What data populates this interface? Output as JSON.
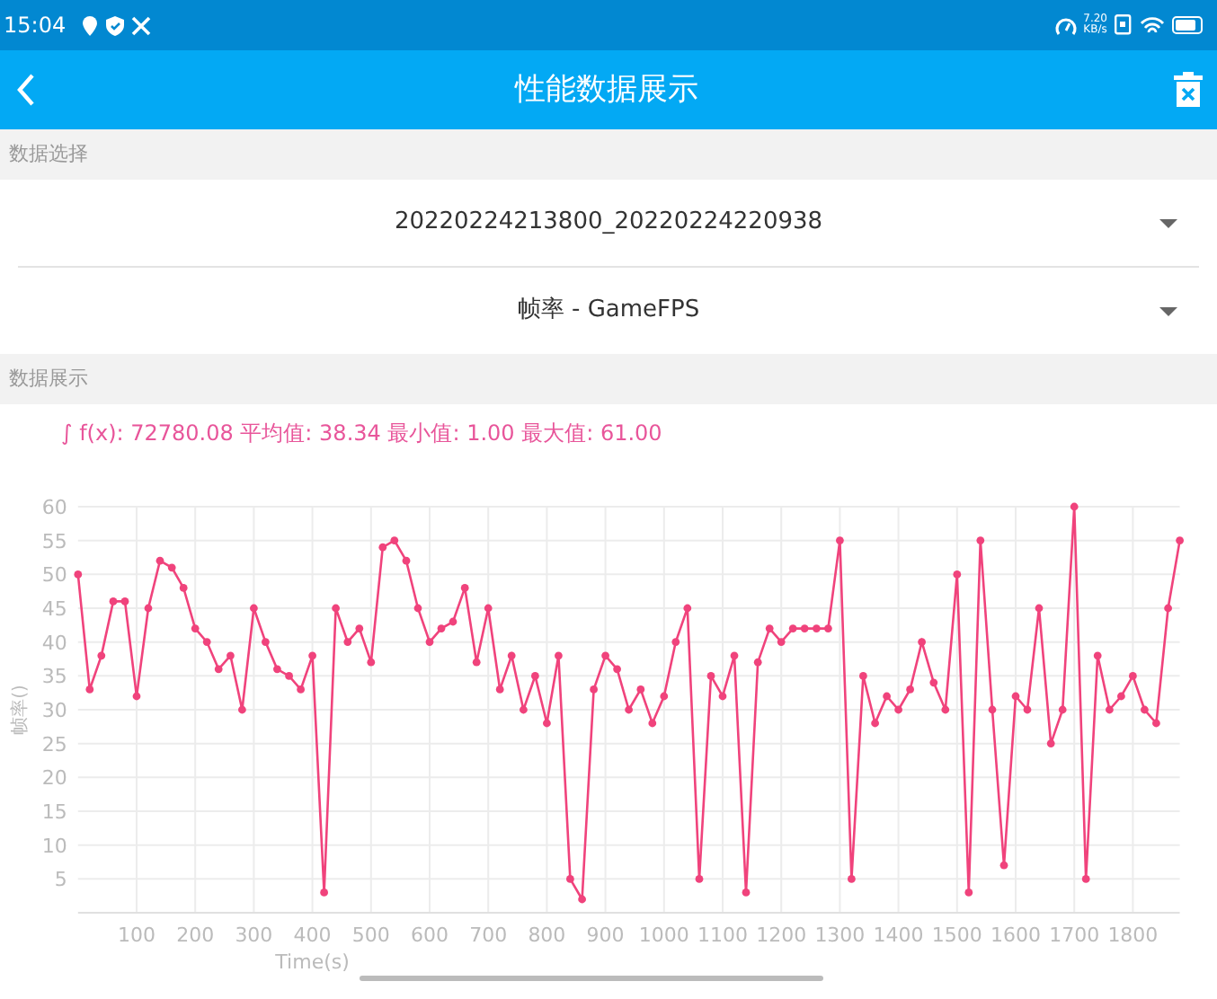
{
  "status_bar": {
    "time": "15:04",
    "net_speed_value": "7.20",
    "net_speed_unit": "KB/s"
  },
  "header": {
    "title": "性能数据展示"
  },
  "sections": [
    {
      "label": "数据选择",
      "dropdowns": [
        {
          "value": "20220224213800_20220224220938"
        },
        {
          "value": "帧率 - GameFPS"
        }
      ]
    },
    {
      "label": "数据展示"
    }
  ],
  "summary": "∫ f(x): 72780.08 平均值: 38.34 最小值: 1.00 最大值: 61.00",
  "chart_data": {
    "type": "line",
    "xlabel": "Time(s)",
    "ylabel": "帧率()",
    "x": [
      0,
      20,
      40,
      60,
      80,
      100,
      120,
      140,
      160,
      180,
      200,
      220,
      240,
      260,
      280,
      300,
      320,
      340,
      360,
      380,
      400,
      420,
      440,
      460,
      480,
      500,
      520,
      540,
      560,
      580,
      600,
      620,
      640,
      660,
      680,
      700,
      720,
      740,
      760,
      780,
      800,
      820,
      840,
      860,
      880,
      900,
      920,
      940,
      960,
      980,
      1000,
      1020,
      1040,
      1060,
      1080,
      1100,
      1120,
      1140,
      1160,
      1180,
      1200,
      1220,
      1240,
      1260,
      1280,
      1300,
      1320,
      1340,
      1360,
      1380,
      1400,
      1420,
      1440,
      1460,
      1480,
      1500,
      1520,
      1540,
      1560,
      1580,
      1600,
      1620,
      1640,
      1660,
      1680,
      1700,
      1720,
      1740,
      1760,
      1780,
      1800,
      1820,
      1840,
      1860,
      1880
    ],
    "grid": true,
    "series": [
      {
        "color": "#f0437c",
        "marker": true,
        "values": [
          50,
          33,
          38,
          46,
          46,
          32,
          45,
          52,
          51,
          48,
          42,
          40,
          36,
          38,
          30,
          45,
          40,
          36,
          35,
          33,
          38,
          3,
          45,
          40,
          42,
          37,
          54,
          55,
          52,
          45,
          40,
          42,
          43,
          48,
          37,
          45,
          33,
          38,
          30,
          35,
          28,
          38,
          5,
          2,
          33,
          38,
          36,
          30,
          33,
          28,
          32,
          40,
          45,
          5,
          35,
          32,
          38,
          3,
          37,
          42,
          40,
          42,
          42,
          42,
          42,
          55,
          5,
          35,
          28,
          32,
          30,
          33,
          40,
          34,
          30,
          50,
          3,
          55,
          30,
          7,
          32,
          30,
          45,
          25,
          30,
          60,
          5,
          38,
          30,
          32,
          35,
          30,
          28,
          45,
          55
        ]
      }
    ],
    "xlim": [
      0,
      1880
    ],
    "ylim": [
      0,
      60
    ],
    "xticks": [
      100,
      200,
      300,
      400,
      500,
      600,
      700,
      800,
      900,
      1000,
      1100,
      1200,
      1300,
      1400,
      1500,
      1600,
      1700,
      1800
    ],
    "yticks": [
      5,
      10,
      15,
      20,
      25,
      30,
      35,
      40,
      45,
      50,
      55,
      60
    ]
  }
}
